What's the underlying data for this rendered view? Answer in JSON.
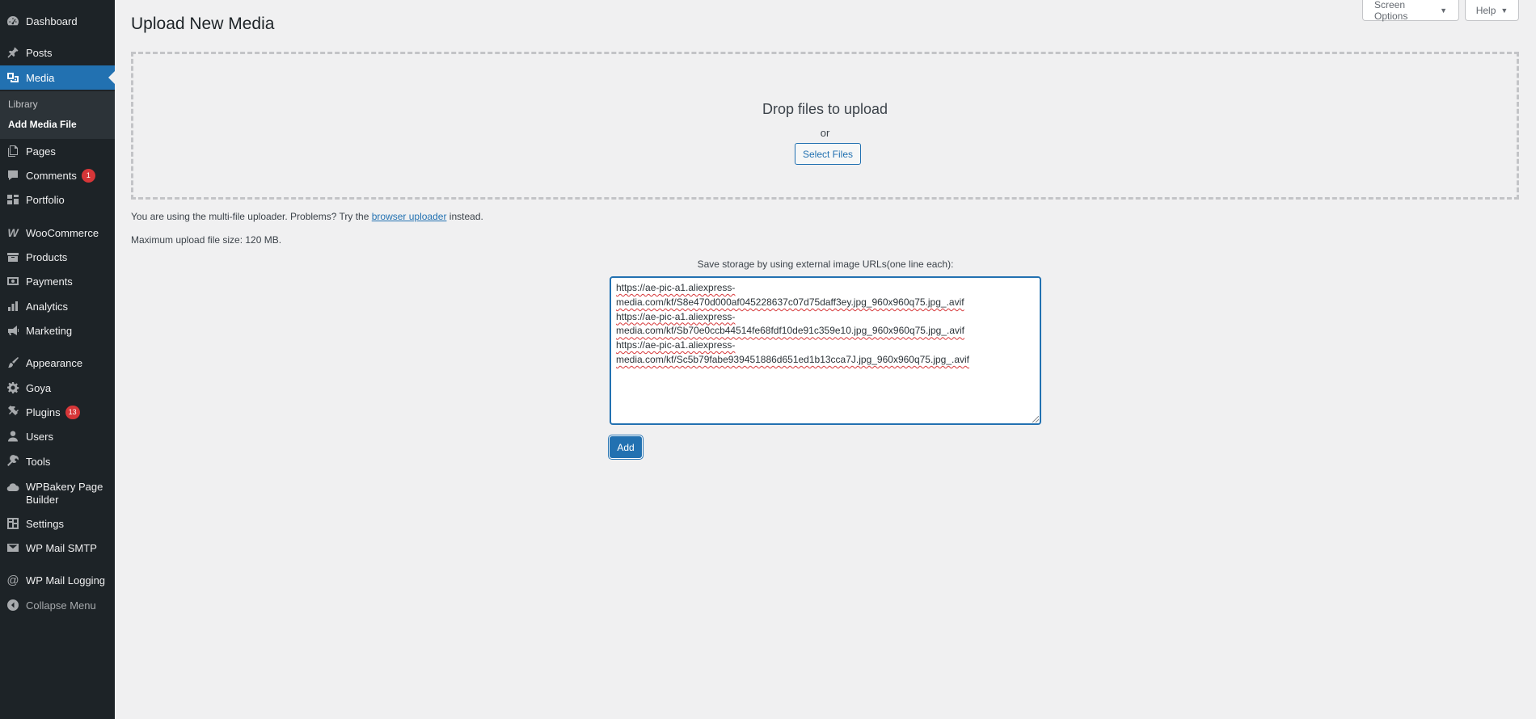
{
  "sidebar": {
    "items": [
      {
        "label": "Dashboard",
        "icon": "dashboard-icon"
      },
      {
        "label": "Posts",
        "icon": "pin-icon"
      },
      {
        "label": "Media",
        "icon": "media-icon"
      },
      {
        "label": "Pages",
        "icon": "pages-icon"
      },
      {
        "label": "Comments",
        "icon": "comment-icon",
        "badge": "1"
      },
      {
        "label": "Portfolio",
        "icon": "portfolio-icon"
      },
      {
        "label": "WooCommerce",
        "icon": "woocommerce-icon"
      },
      {
        "label": "Products",
        "icon": "products-icon"
      },
      {
        "label": "Payments",
        "icon": "payments-icon"
      },
      {
        "label": "Analytics",
        "icon": "analytics-icon"
      },
      {
        "label": "Marketing",
        "icon": "megaphone-icon"
      },
      {
        "label": "Appearance",
        "icon": "paintbrush-icon"
      },
      {
        "label": "Goya",
        "icon": "gear-icon"
      },
      {
        "label": "Plugins",
        "icon": "plug-icon",
        "badge": "13"
      },
      {
        "label": "Users",
        "icon": "user-icon"
      },
      {
        "label": "Tools",
        "icon": "wrench-icon"
      },
      {
        "label": "WPBakery Page Builder",
        "icon": "cloud-icon"
      },
      {
        "label": "Settings",
        "icon": "settings-icon"
      },
      {
        "label": "WP Mail SMTP",
        "icon": "mail-icon"
      },
      {
        "label": "WP Mail Logging",
        "icon": "at-icon"
      },
      {
        "label": "Collapse Menu",
        "icon": "collapse-icon"
      }
    ],
    "submenu": [
      "Library",
      "Add Media File"
    ]
  },
  "top_tabs": {
    "screen_options": "Screen Options",
    "help": "Help"
  },
  "page": {
    "title": "Upload New Media",
    "drop_heading": "Drop files to upload",
    "drop_or": "or",
    "select_files": "Select Files",
    "uploader_note_prefix": "You are using the multi-file uploader. Problems? Try the",
    "uploader_note_link": "browser uploader",
    "uploader_note_suffix": "instead.",
    "max_size": "Maximum upload file size: 120 MB.",
    "external_label": "Save storage by using external image URLs(one line each):",
    "external_urls": "https://ae-pic-a1.aliexpress-\nmedia.com/kf/S8e470d000af045228637c07d75daff3ey.jpg_960x960q75.jpg_.avif\nhttps://ae-pic-a1.aliexpress-\nmedia.com/kf/Sb70e0ccb44514fe68fdf10de91c359e10.jpg_960x960q75.jpg_.avif\nhttps://ae-pic-a1.aliexpress-\nmedia.com/kf/Sc5b79fabe939451886d651ed1b13cca7J.jpg_960x960q75.jpg_.avif",
    "add_button": "Add"
  },
  "colors": {
    "sidebar_bg": "#1d2327",
    "accent": "#2271b1",
    "badge": "#d63638",
    "page_bg": "#f0f0f1"
  }
}
